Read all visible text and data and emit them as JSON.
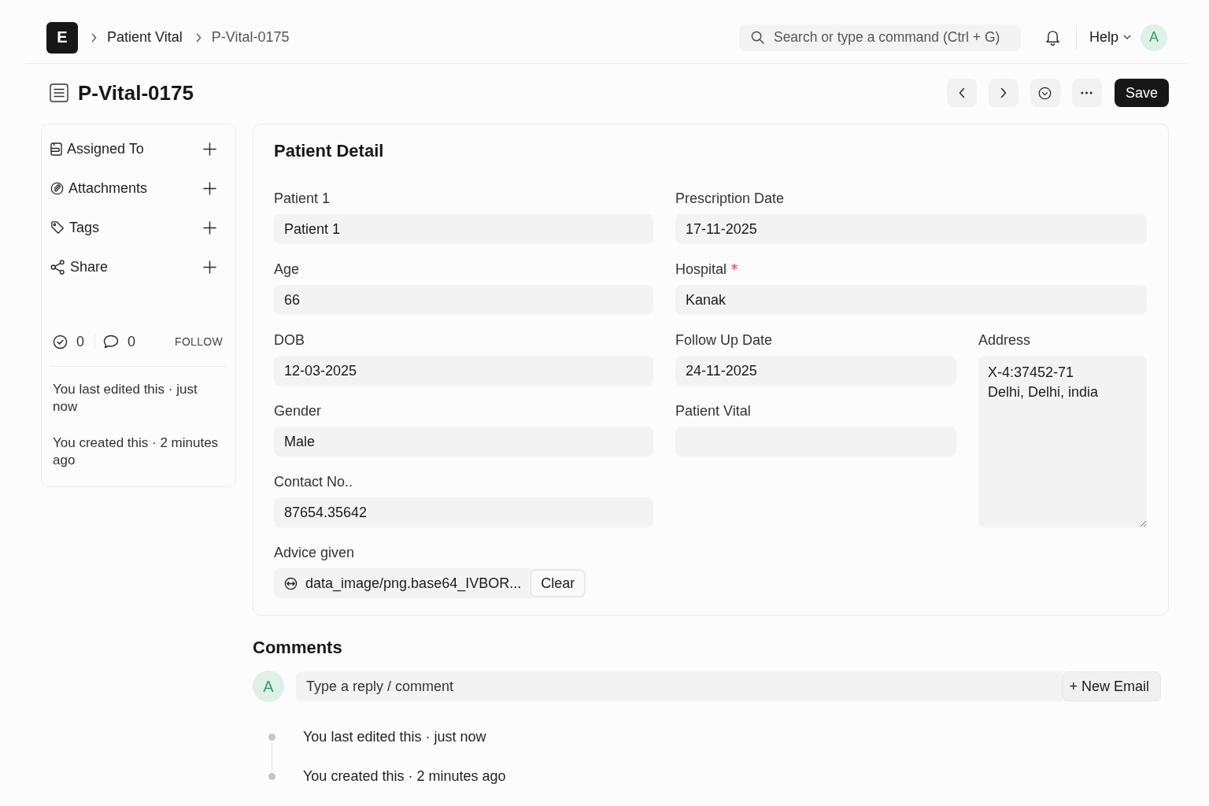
{
  "topbar": {
    "logo": "E",
    "breadcrumbs": [
      "Patient Vital",
      "P-Vital-0175"
    ],
    "search": {
      "placeholder": "Search or type a command (Ctrl + G)"
    },
    "help": "Help",
    "avatar": "A"
  },
  "header": {
    "title": "P-Vital-0175",
    "save_button": "Save"
  },
  "sidebar": {
    "items": [
      {
        "label": "Assigned To"
      },
      {
        "label": "Attachments"
      },
      {
        "label": "Tags"
      },
      {
        "label": "Share"
      }
    ],
    "likes": "0",
    "comments": "0",
    "follow": "FOLLOW",
    "activity": [
      "You last edited this · just now",
      "You created this · 2 minutes ago"
    ]
  },
  "form": {
    "title": "Patient Detail",
    "sections": [
      {
        "columns": [
          [
            {
              "label": "Patient 1",
              "kind": "text",
              "value": "Patient 1",
              "required": false
            },
            {
              "label": "Age",
              "kind": "text",
              "value": "66",
              "required": false
            }
          ],
          [
            {
              "label": "Prescription Date",
              "kind": "text",
              "value": "17-11-2025",
              "required": false
            },
            {
              "label": "Hospital",
              "kind": "text",
              "value": "Kanak",
              "required": true
            }
          ]
        ]
      },
      {
        "columns": [
          [
            {
              "label": "DOB",
              "kind": "text",
              "value": "12-03-2025",
              "required": false
            },
            {
              "label": "Gender",
              "kind": "text",
              "value": "Male",
              "required": false
            },
            {
              "label": "Contact No..",
              "kind": "text",
              "value": "87654.35642",
              "required": false
            },
            {
              "label": "Advice given",
              "kind": "attach",
              "value": "data_image/png.base64_IVBOR...",
              "clear_button": "Clear",
              "required": false
            }
          ],
          [
            {
              "label": "Follow Up Date",
              "kind": "text",
              "value": "24-11-2025",
              "required": false
            },
            {
              "label": "Patient Vital",
              "kind": "text",
              "required": false
            }
          ],
          [
            {
              "label": "Address",
              "kind": "textarea",
              "value": "X-4:37452-71\nDelhi, Delhi, india",
              "required": false
            }
          ]
        ]
      }
    ]
  },
  "comments": {
    "title": "Comments",
    "avatar": "A",
    "placeholder": "Type a reply / comment",
    "new_email_button": "+ New Email",
    "timeline": [
      "You last edited this · just now",
      "You created this · 2 minutes ago"
    ]
  }
}
